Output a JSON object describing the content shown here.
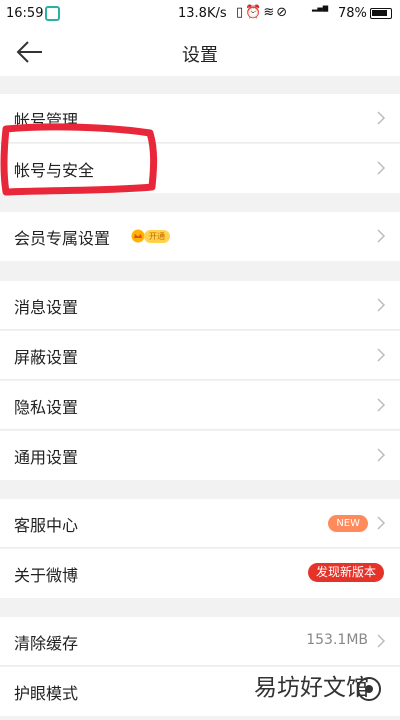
{
  "status_bar": {
    "time": "16:59",
    "net_speed": "13.8K/s",
    "signal_label": "3G\n2G",
    "battery_pct": "78%"
  },
  "header": {
    "title": "设置"
  },
  "groups": {
    "account": [
      "帐号管理",
      "帐号与安全"
    ],
    "vip": {
      "label": "会员专属设置",
      "tag": "开通"
    },
    "notify": [
      "消息设置",
      "屏蔽设置",
      "隐私设置",
      "通用设置"
    ],
    "service": {
      "support": "客服中心",
      "support_badge": "NEW",
      "about": "关于微博",
      "about_badge": "发现新版本"
    },
    "misc": {
      "cache": "清除缓存",
      "cache_value": "153.1MB",
      "eye": "护眼模式"
    }
  },
  "watermark": "易坊好文馆",
  "colors": {
    "highlight_stroke": "#e8283a",
    "badge_new": "#ff8a5c",
    "badge_update": "#e6332a",
    "vip_tag": "#ffd34d"
  }
}
